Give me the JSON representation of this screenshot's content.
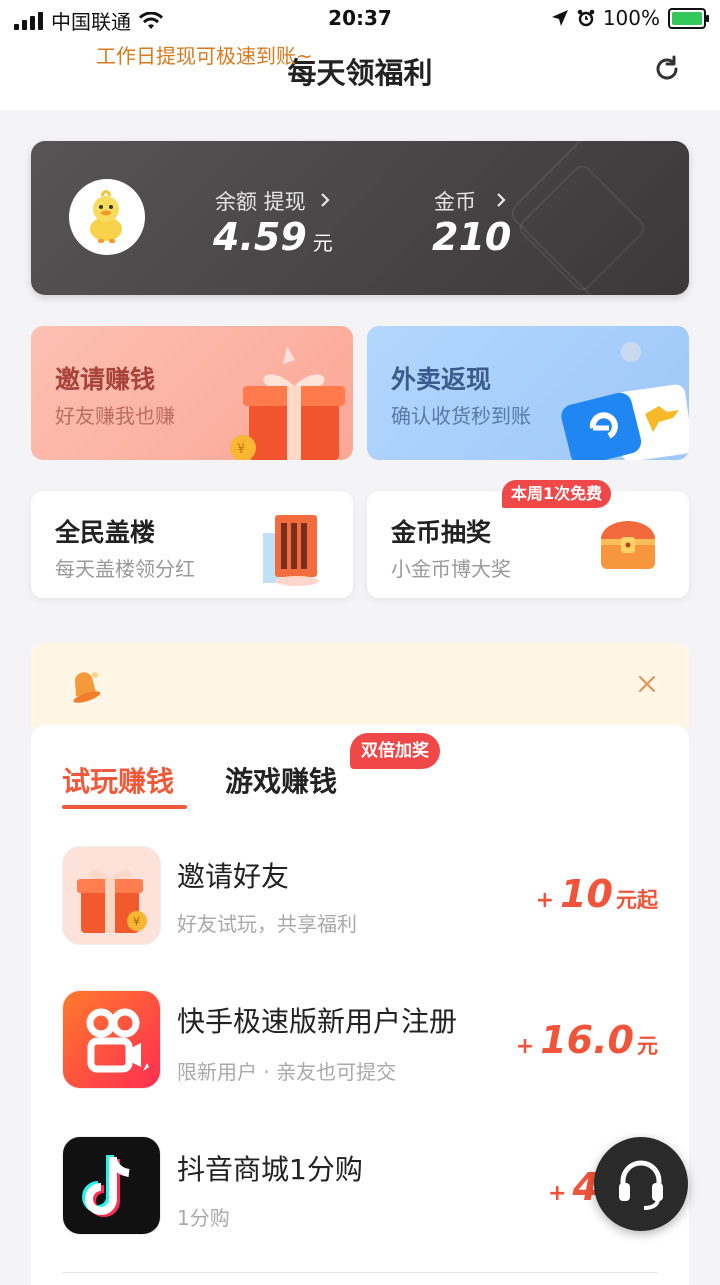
{
  "status_bar": {
    "carrier": "中国联通",
    "time": "20:37",
    "battery": "100%"
  },
  "nav": {
    "title": "每天领福利",
    "refresh_icon": "refresh-icon"
  },
  "balance": {
    "balance_label": "余额 提现",
    "balance_value": "4.59",
    "balance_unit": "元",
    "coin_label": "金币",
    "coin_value": "210"
  },
  "promos": [
    {
      "title": "邀请赚钱",
      "subtitle": "好友赚我也赚",
      "bg": "#fbb5a6",
      "title_color": "#a8433a",
      "sub_color": "#bd6c62"
    },
    {
      "title": "外卖返现",
      "subtitle": "确认收货秒到账",
      "bg": "#a9cffb",
      "title_color": "#3a5b8c",
      "sub_color": "#5a7aa6"
    }
  ],
  "features": [
    {
      "title": "全民盖楼",
      "subtitle": "每天盖楼领分红"
    },
    {
      "title": "金币抽奖",
      "subtitle": "小金币博大奖",
      "badge": "本周1次免费"
    }
  ],
  "notice": {
    "text": "工作日提现可极速到账~"
  },
  "tabs": [
    {
      "label": "试玩赚钱",
      "active": true
    },
    {
      "label": "游戏赚钱",
      "active": false,
      "badge": "双倍加奖"
    }
  ],
  "tasks": [
    {
      "title": "邀请好友",
      "subtitle": "好友试玩，共享福利",
      "plus": "+",
      "amount": "10",
      "unit": "元起"
    },
    {
      "title": "快手极速版新用户注册",
      "subtitle": "限新用户 · 亲友也可提交",
      "plus": "+",
      "amount": "16.0",
      "unit": "元"
    },
    {
      "title": "抖音商城1分购",
      "subtitle": "1分购",
      "plus": "+",
      "amount": "4.0",
      "unit": ""
    }
  ],
  "colors": {
    "accent": "#f05a3a",
    "reward": "#f0543a",
    "notice_text": "#d87a1c"
  }
}
